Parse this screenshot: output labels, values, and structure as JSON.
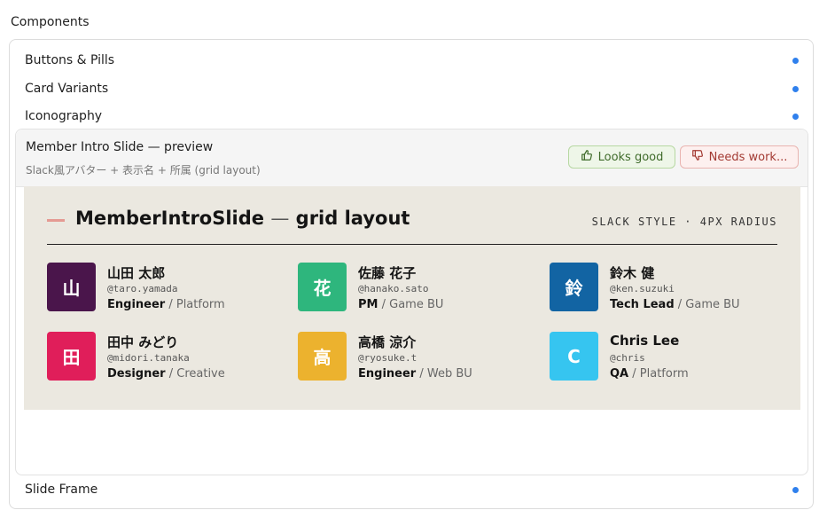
{
  "page": {
    "title": "Components"
  },
  "nav": {
    "buttons_pills": "Buttons & Pills",
    "card_variants": "Card Variants",
    "iconography": "Iconography",
    "slide_frame": "Slide Frame"
  },
  "expanded": {
    "title": "Member Intro Slide — preview",
    "subtitle": "Slack風アバター + 表示名 + 所属 (grid layout)",
    "looks_good": "Looks good",
    "needs_work": "Needs work..."
  },
  "preview": {
    "title": "MemberIntroSlide",
    "title_sep": "—",
    "title_suffix": "grid layout",
    "tag": "SLACK STYLE · 4PX RADIUS",
    "members": [
      {
        "initial": "山",
        "name": "山田 太郎",
        "handle": "@taro.yamada",
        "role": "Engineer",
        "dept": "Platform",
        "color": "#4a154b"
      },
      {
        "initial": "花",
        "name": "佐藤 花子",
        "handle": "@hanako.sato",
        "role": "PM",
        "dept": "Game BU",
        "color": "#2eb67d"
      },
      {
        "initial": "鈴",
        "name": "鈴木 健",
        "handle": "@ken.suzuki",
        "role": "Tech Lead",
        "dept": "Game BU",
        "color": "#1264a3"
      },
      {
        "initial": "田",
        "name": "田中 みどり",
        "handle": "@midori.tanaka",
        "role": "Designer",
        "dept": "Creative",
        "color": "#e01e5a"
      },
      {
        "initial": "高",
        "name": "高橋 涼介",
        "handle": "@ryosuke.t",
        "role": "Engineer",
        "dept": "Web BU",
        "color": "#ecb22e"
      },
      {
        "initial": "C",
        "name": "Chris Lee",
        "handle": "@chris",
        "role": "QA",
        "dept": "Platform",
        "color": "#36c5f0"
      }
    ]
  },
  "colors": {
    "dot": "#2f80ed",
    "accent": "#e59a93",
    "preview_bg": "#ebe8e0"
  }
}
